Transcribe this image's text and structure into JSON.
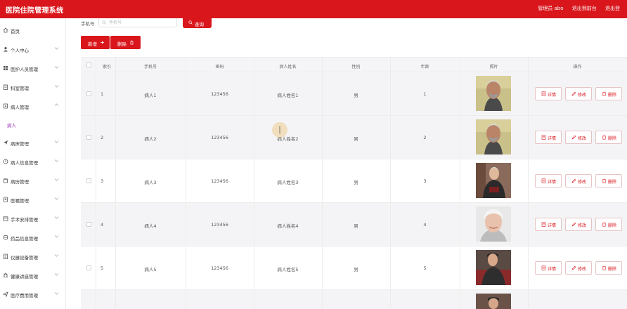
{
  "header": {
    "app_title": "医院住院管理系统",
    "user_label": "管理员 abo",
    "exit_to_front": "退出到前台",
    "logout": "退出登"
  },
  "sidebar": {
    "items": [
      {
        "label": "首页",
        "icon": "home-icon"
      },
      {
        "label": "个人中心",
        "icon": "user-icon"
      },
      {
        "label": "医护人员管理",
        "icon": "grid-icon"
      },
      {
        "label": "科室管理",
        "icon": "building-icon"
      },
      {
        "label": "病人管理",
        "icon": "patient-icon",
        "expanded": true
      },
      {
        "label": "病床管理",
        "icon": "send-icon"
      },
      {
        "label": "病人信息管理",
        "icon": "clock-icon"
      },
      {
        "label": "病历管理",
        "icon": "record-icon"
      },
      {
        "label": "医嘱管理",
        "icon": "note-icon"
      },
      {
        "label": "手术安排管理",
        "icon": "calendar-icon"
      },
      {
        "label": "药品信息管理",
        "icon": "pill-icon"
      },
      {
        "label": "仪器设备管理",
        "icon": "device-icon"
      },
      {
        "label": "健康讲座管理",
        "icon": "lecture-icon"
      },
      {
        "label": "医疗费用管理",
        "icon": "fee-icon"
      }
    ],
    "submenu": {
      "label": "病人"
    }
  },
  "search": {
    "label": "手机号",
    "placeholder": "手机号",
    "button_label": "查询"
  },
  "toolbar": {
    "add_label": "新增",
    "delete_label": "删除"
  },
  "table": {
    "columns": [
      "索引",
      "手机号",
      "密码",
      "病人姓名",
      "性别",
      "年龄",
      "照片",
      "操作"
    ],
    "rows": [
      {
        "index": "1",
        "phone": "病人1",
        "password": "123456",
        "name": "病人姓名1",
        "gender": "男",
        "age": "1"
      },
      {
        "index": "2",
        "phone": "病人2",
        "password": "123456",
        "name": "病人姓名2",
        "gender": "男",
        "age": "2"
      },
      {
        "index": "3",
        "phone": "病人3",
        "password": "123456",
        "name": "病人姓名3",
        "gender": "男",
        "age": "3"
      },
      {
        "index": "4",
        "phone": "病人4",
        "password": "123456",
        "name": "病人姓名4",
        "gender": "男",
        "age": "4"
      },
      {
        "index": "5",
        "phone": "病人5",
        "password": "123456",
        "name": "病人姓名5",
        "gender": "男",
        "age": "5"
      }
    ],
    "actions": {
      "detail": "详情",
      "edit": "修改",
      "delete": "删除"
    }
  },
  "colors": {
    "brand_red": "#d9161c",
    "submenu_purple": "#9b2fb8",
    "row_alt": "#f4f4f6"
  }
}
